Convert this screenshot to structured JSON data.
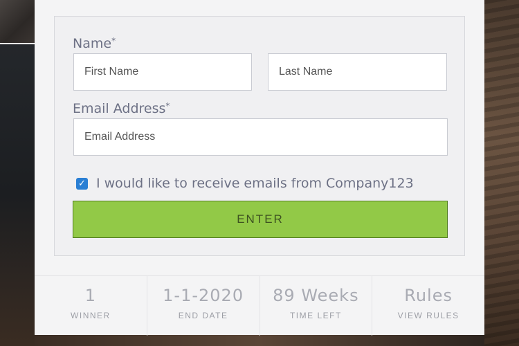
{
  "form": {
    "name_label": "Name",
    "name_required": "*",
    "first_name_placeholder": "First Name",
    "last_name_placeholder": "Last Name",
    "email_label": "Email Address",
    "email_required": "*",
    "email_placeholder": "Email Address",
    "checkbox_checked": true,
    "checkbox_mark": "✓",
    "checkbox_label": "I would like to receive emails from Company123",
    "enter_label": "ENTER"
  },
  "stats": [
    {
      "value": "1",
      "label": "WINNER"
    },
    {
      "value": "1-1-2020",
      "label": "END DATE"
    },
    {
      "value": "89 Weeks",
      "label": "TIME LEFT"
    },
    {
      "value": "Rules",
      "label": "VIEW RULES"
    }
  ],
  "colors": {
    "button": "#92c947",
    "checkbox": "#2a7fd4",
    "label_text": "#6d7185"
  }
}
